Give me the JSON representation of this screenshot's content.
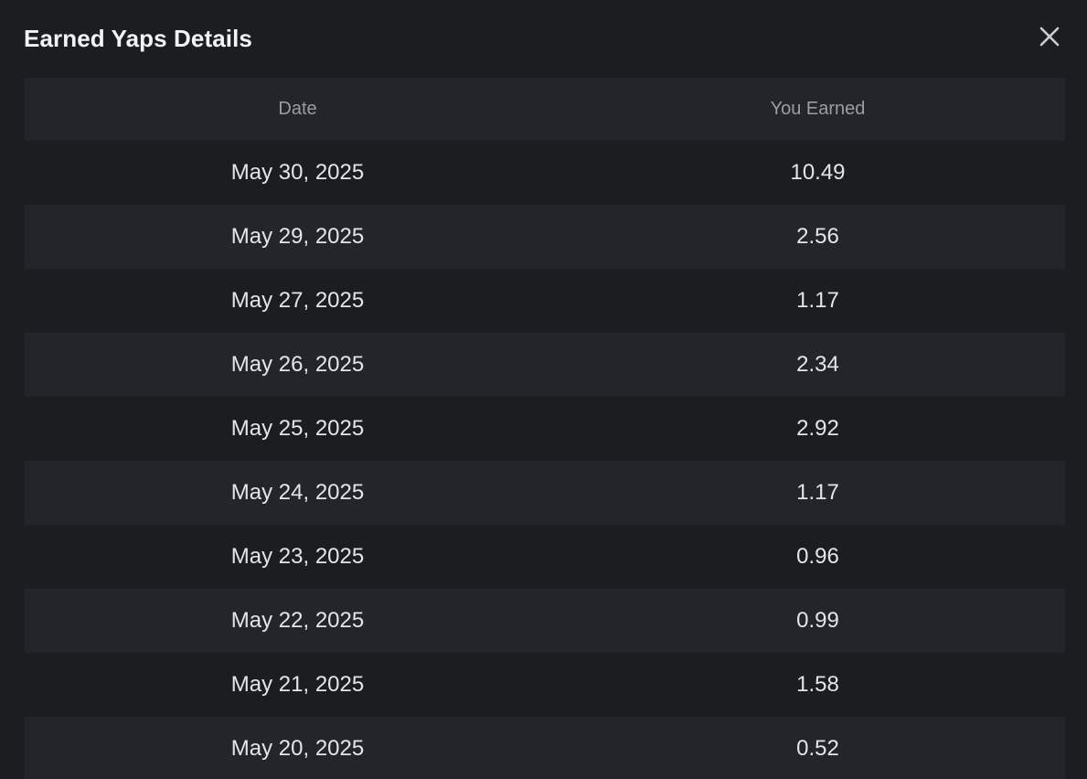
{
  "modal": {
    "title": "Earned Yaps Details",
    "close_icon": "close-icon"
  },
  "table": {
    "columns": [
      "Date",
      "You Earned"
    ],
    "rows": [
      {
        "date": "May 30, 2025",
        "earned": "10.49"
      },
      {
        "date": "May 29, 2025",
        "earned": "2.56"
      },
      {
        "date": "May 27, 2025",
        "earned": "1.17"
      },
      {
        "date": "May 26, 2025",
        "earned": "2.34"
      },
      {
        "date": "May 25, 2025",
        "earned": "2.92"
      },
      {
        "date": "May 24, 2025",
        "earned": "1.17"
      },
      {
        "date": "May 23, 2025",
        "earned": "0.96"
      },
      {
        "date": "May 22, 2025",
        "earned": "0.99"
      },
      {
        "date": "May 21, 2025",
        "earned": "1.58"
      },
      {
        "date": "May 20, 2025",
        "earned": "0.52"
      }
    ]
  },
  "colors": {
    "background": "#1b1e21",
    "row_alt": "#22262a",
    "title": "#f2f3f4",
    "header_text": "#9a9ea3",
    "cell_text": "#e3e5e7"
  }
}
